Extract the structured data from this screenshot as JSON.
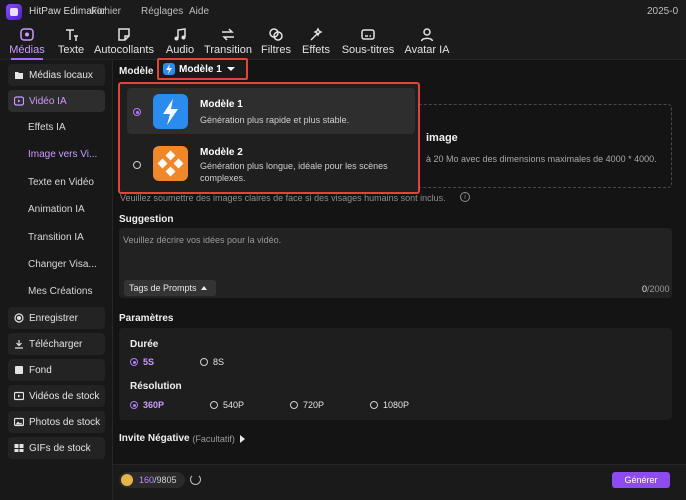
{
  "titlebar": {
    "app_title": "HitPaw Edimakor",
    "menus": [
      "Fichier",
      "Réglages",
      "Aide"
    ],
    "date_fragment": "2025-0"
  },
  "toolbar": {
    "tabs": [
      {
        "label": "Médias",
        "icon": "media-icon",
        "active": true
      },
      {
        "label": "Texte",
        "icon": "text-icon"
      },
      {
        "label": "Autocollants",
        "icon": "sticker-icon"
      },
      {
        "label": "Audio",
        "icon": "audio-icon"
      },
      {
        "label": "Transition",
        "icon": "transition-icon"
      },
      {
        "label": "Filtres",
        "icon": "filter-icon"
      },
      {
        "label": "Effets",
        "icon": "effects-icon"
      },
      {
        "label": "Sous-titres",
        "icon": "subtitles-icon"
      },
      {
        "label": "Avatar IA",
        "icon": "avatar-icon"
      }
    ]
  },
  "sidebar": {
    "top_items": [
      {
        "label": "Médias locaux",
        "icon": "folder-icon"
      },
      {
        "label": "Vidéo IA",
        "icon": "ai-video-icon",
        "active": true
      }
    ],
    "sub_items": [
      {
        "label": "Effets IA"
      },
      {
        "label": "Image vers Vi...",
        "active": true
      },
      {
        "label": "Texte en Vidéo"
      },
      {
        "label": "Animation IA"
      },
      {
        "label": "Transition IA"
      },
      {
        "label": "Changer Visa..."
      },
      {
        "label": "Mes Créations"
      }
    ],
    "bottom_items": [
      {
        "label": "Enregistrer",
        "icon": "record-icon"
      },
      {
        "label": "Télécharger",
        "icon": "download-icon"
      },
      {
        "label": "Fond",
        "icon": "background-icon"
      },
      {
        "label": "Vidéos de stock",
        "icon": "stock-video-icon"
      },
      {
        "label": "Photos de stock",
        "icon": "stock-photo-icon"
      },
      {
        "label": "GIFs de stock",
        "icon": "gif-icon"
      }
    ]
  },
  "model": {
    "label": "Modèle",
    "selected": "Modèle 1",
    "options": [
      {
        "title": "Modèle 1",
        "desc": "Génération plus rapide et plus stable.",
        "selected": true,
        "icon": "lightning-icon",
        "color": "#2b8cf0"
      },
      {
        "title": "Modèle 2",
        "desc": "Génération plus longue, idéale pour les scènes complexes.",
        "selected": false,
        "icon": "diamond-cluster-icon",
        "color": "#f0872a"
      }
    ]
  },
  "upload": {
    "title": "image",
    "desc": "à 20 Mo avec des dimensions maximales de 4000 * 4000.",
    "note": "Veuillez soumettre des images claires de face si des visages humains sont inclus."
  },
  "suggestion": {
    "label": "Suggestion",
    "placeholder": "Veuillez décrire vos idées pour la vidéo.",
    "tags_button": "Tags de Prompts",
    "count": "0",
    "max": "/2000"
  },
  "params": {
    "label": "Paramètres",
    "duration_label": "Durée",
    "durations": [
      {
        "label": "5S",
        "on": true
      },
      {
        "label": "8S",
        "on": false
      }
    ],
    "resolution_label": "Résolution",
    "resolutions": [
      {
        "label": "360P",
        "on": true
      },
      {
        "label": "540P"
      },
      {
        "label": "720P"
      },
      {
        "label": "1080P"
      }
    ]
  },
  "negative": {
    "label": "Invite Négative",
    "optional": "(Facultatif)"
  },
  "footer": {
    "credits_used": "160",
    "credits_total": "/9805",
    "generate": "Générer"
  },
  "colors": {
    "accent": "#a66bff",
    "highlight_border": "#e0443a",
    "generate_bg": "#8d4bf0"
  }
}
